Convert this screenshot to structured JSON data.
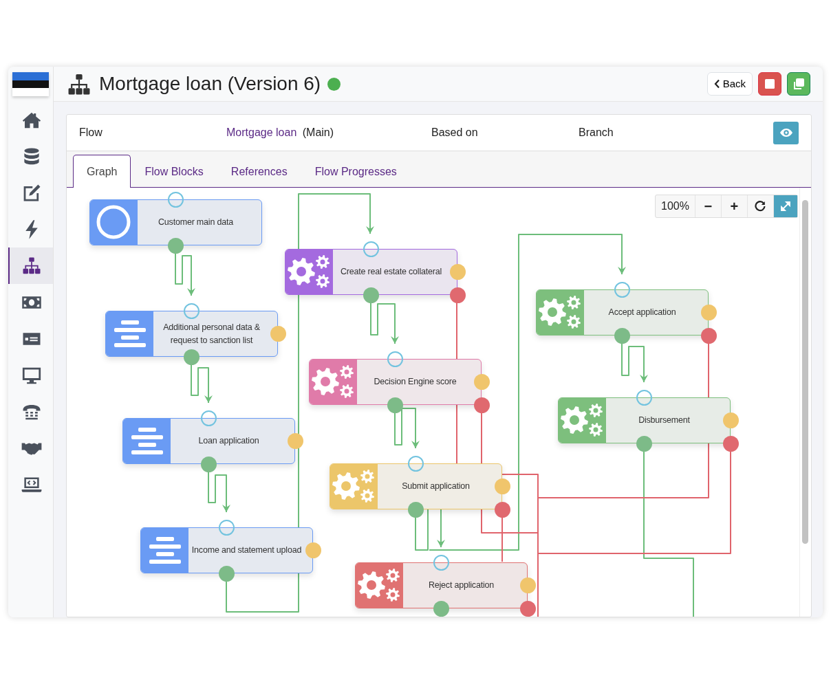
{
  "sidebar": {
    "items": [
      {
        "selected": false
      },
      {
        "selected": false
      },
      {
        "selected": false
      },
      {
        "selected": false
      },
      {
        "selected": true
      },
      {
        "selected": false
      },
      {
        "selected": false
      },
      {
        "selected": false
      },
      {
        "selected": false
      },
      {
        "selected": false
      },
      {
        "selected": false
      }
    ]
  },
  "header": {
    "title": "Mortgage loan (Version 6)",
    "active": true,
    "buttons": [
      {
        "kind": "back",
        "label": "Back"
      },
      {
        "kind": "stop"
      },
      {
        "kind": "copy"
      }
    ]
  },
  "info": {
    "flow_label": "Flow",
    "flow_link": "Mortgage loan",
    "flow_branch": "(Main)",
    "based_on_label": "Based on",
    "branch_label": "Branch"
  },
  "tabs": [
    {
      "label": "Graph",
      "selected": true
    },
    {
      "label": "Flow Blocks",
      "selected": false
    },
    {
      "label": "References",
      "selected": false
    },
    {
      "label": "Flow Progresses",
      "selected": false
    }
  ],
  "zoom": {
    "value": "100%",
    "buttons": [
      {
        "kind": "out",
        "label": "−"
      },
      {
        "kind": "in",
        "label": "+"
      },
      {
        "kind": "reset"
      },
      {
        "kind": "fullscreen"
      }
    ]
  },
  "nodes": [
    {
      "label": "Customer main data",
      "kind": "start",
      "color": "#6a9bf4"
    },
    {
      "label": "Additional personal data & request to sanction list",
      "kind": "form",
      "color": "#6a9bf4"
    },
    {
      "label": "Loan application",
      "kind": "form",
      "color": "#6a9bf4"
    },
    {
      "label": "Income and statement upload",
      "kind": "form",
      "color": "#6a9bf4"
    },
    {
      "label": "Create real estate collateral",
      "kind": "task",
      "color": "#a46adf"
    },
    {
      "label": "Decision Engine score",
      "kind": "task",
      "color": "#e07ba9"
    },
    {
      "label": "Submit application",
      "kind": "task",
      "color": "#ecc66a"
    },
    {
      "label": "Reject application",
      "kind": "task",
      "color": "#e07272"
    },
    {
      "label": "Accept application",
      "kind": "task",
      "color": "#7dbf7d"
    },
    {
      "label": "Disbursement",
      "kind": "task",
      "color": "#7dbf7d"
    }
  ]
}
